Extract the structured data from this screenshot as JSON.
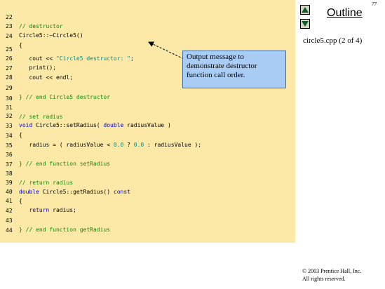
{
  "slide": {
    "page_number": "77",
    "outline_title": "Outline",
    "file_label": "circle5.cpp  (2 of 4)",
    "copyright_line1": "© 2003 Prentice Hall, Inc.",
    "copyright_line2": "All rights reserved."
  },
  "nav": {
    "up_icon": "triangle-up-icon",
    "down_icon": "triangle-down-icon"
  },
  "callout": {
    "line1": "Output message to",
    "line2": "demonstrate destructor",
    "line3": "function call order."
  },
  "code": {
    "lines": [
      {
        "n": "22",
        "t": "// destructor"
      },
      {
        "n": "23",
        "t": "Circle5::~Circle5()"
      },
      {
        "n": "24",
        "t": "{"
      },
      {
        "n": "25",
        "t": "   cout << \"Circle5 destructor: \";"
      },
      {
        "n": "26",
        "t": "   print();"
      },
      {
        "n": "27",
        "t": "   cout << endl;"
      },
      {
        "n": "28",
        "t": ""
      },
      {
        "n": "29",
        "t": "} // end Circle5 destructor"
      },
      {
        "n": "30",
        "t": ""
      },
      {
        "n": "31",
        "t": "// set radius"
      },
      {
        "n": "32",
        "t": "void Circle5::setRadius( double radiusValue )"
      },
      {
        "n": "33",
        "t": "{"
      },
      {
        "n": "34",
        "t": "   radius = ( radiusValue < 0.0 ? 0.0 : radiusValue );"
      },
      {
        "n": "35",
        "t": ""
      },
      {
        "n": "36",
        "t": "} // end function setRadius"
      },
      {
        "n": "37",
        "t": ""
      },
      {
        "n": "38",
        "t": "// return radius"
      },
      {
        "n": "39",
        "t": "double Circle5::getRadius() const"
      },
      {
        "n": "40",
        "t": "{"
      },
      {
        "n": "41",
        "t": "   return radius;"
      },
      {
        "n": "42",
        "t": ""
      },
      {
        "n": "43",
        "t": "} // end function getRadius"
      },
      {
        "n": "44",
        "t": ""
      }
    ]
  },
  "colors": {
    "code_background": "#fce9a7",
    "callout_background": "#a9ccf5",
    "comment": "#0a8a0a",
    "keyword": "#0000cc",
    "literal": "#008b8b"
  }
}
